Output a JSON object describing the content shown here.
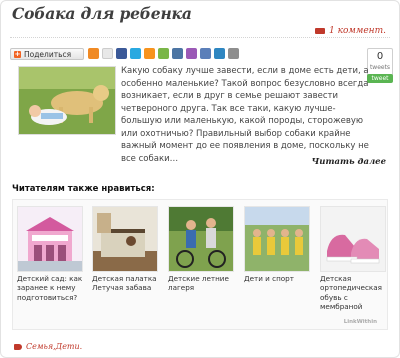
{
  "post": {
    "title": "Собака для ребенка",
    "comments": "1 коммент.",
    "excerpt": "Какую собаку лучше завести, если в доме есть дети, а особенно маленькие? Такой вопрос безусловно всегда возникает, если в друг в семье решают завести четвероного друга. Так все таки, какую лучше- большую или маленькую, какой породы, сторожевую или охотничью? Правильный выбор собаки крайне важный момент до ее появления в доме, поскольку не все собаки…",
    "read_more": "Читать далее",
    "tags": "Семья,Дети."
  },
  "share": {
    "label": "Поделиться",
    "tweet_count": "0",
    "tweets_label": "tweets",
    "tweet_button": "tweet"
  },
  "related": {
    "title": "Читателям также нравиться:",
    "items": [
      {
        "caption": "Детский сад: как заранее к нему подготовиться?"
      },
      {
        "caption": "Детская палатка Летучая забава"
      },
      {
        "caption": "Детские летние лагеря"
      },
      {
        "caption": "Дети и спорт"
      },
      {
        "caption": "Детская ортопедическая обувь с мембраной"
      }
    ],
    "credit": "LinkWithin"
  },
  "colors": {
    "accent": "#c0392b",
    "tweet": "#5ab552"
  }
}
